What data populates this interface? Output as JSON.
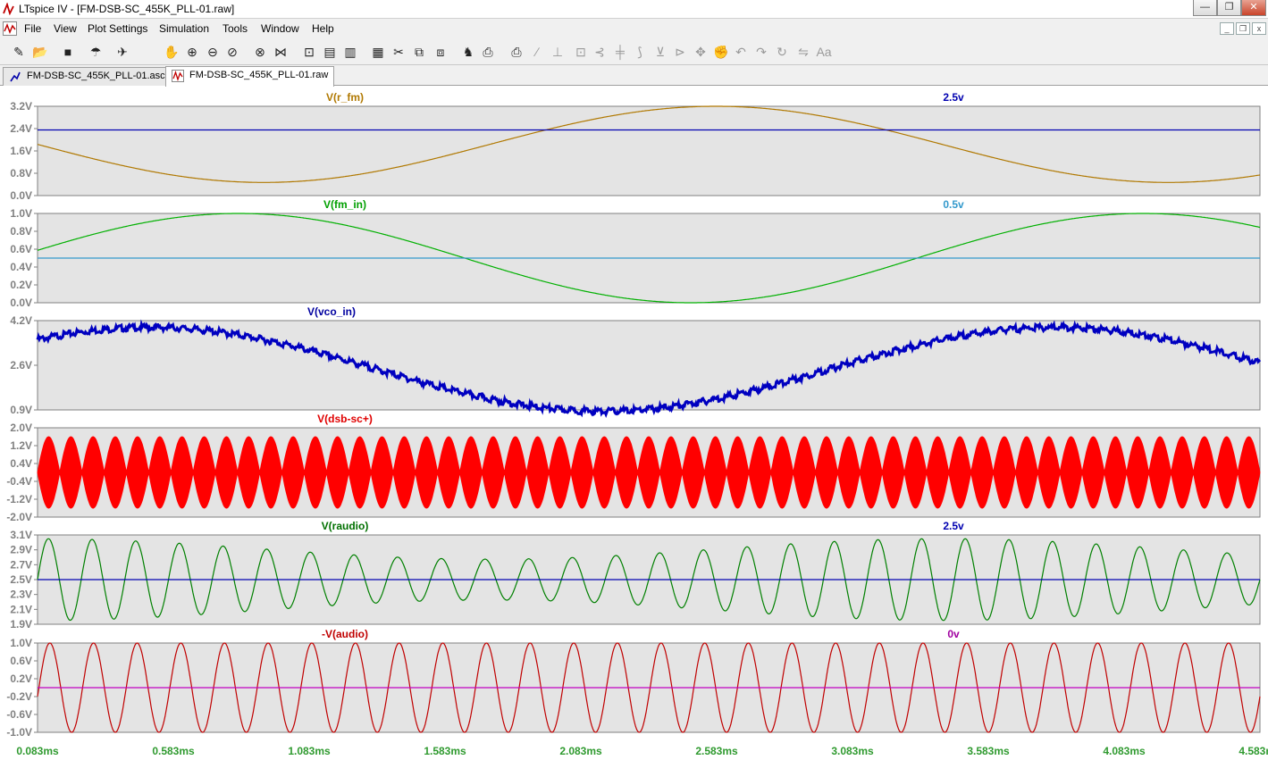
{
  "window": {
    "title": "LTspice IV - [FM-DSB-SC_455K_PLL-01.raw]",
    "controls": [
      "minimize",
      "maximize",
      "close"
    ]
  },
  "menu": {
    "items": [
      "File",
      "View",
      "Plot Settings",
      "Simulation",
      "Tools",
      "Window",
      "Help"
    ]
  },
  "toolbar": {
    "icons": [
      "new-schematic-icon",
      "open-icon",
      "save-icon",
      "control-panel-icon",
      "run-icon",
      "halt-icon",
      "zoom-in-icon",
      "zoom-out-icon",
      "zoom-back-icon",
      "zoom-cancel-icon",
      "autorange-icon",
      "fit-icon",
      "tile-horizontal-icon",
      "cascade-icon",
      "close-window-icon",
      "cut-icon",
      "copy-icon",
      "paste-icon",
      "find-icon",
      "print-setup-icon",
      "print-icon",
      "wire-icon",
      "ground-icon",
      "label-icon",
      "resistor-icon",
      "capacitor-icon",
      "inductor-icon",
      "diode-icon",
      "component-icon",
      "move-icon",
      "drag-icon",
      "undo-icon",
      "redo-icon",
      "rotate-icon",
      "mirror-icon",
      "text-icon",
      "spice-directive-icon"
    ]
  },
  "tabs": [
    {
      "label": "FM-DSB-SC_455K_PLL-01.asc",
      "active": false,
      "icon": "schematic-icon"
    },
    {
      "label": "FM-DSB-SC_455K_PLL-01.raw",
      "active": true,
      "icon": "waveform-icon"
    }
  ],
  "chart_data": [
    {
      "type": "line",
      "title": "V(r_fm)",
      "title_color": "#b07800",
      "ticks": [
        "3.2V",
        "2.4V",
        "1.6V",
        "0.8V",
        "0.0V"
      ],
      "ylim": [
        0.0,
        3.4
      ],
      "series": [
        {
          "name": "V(r_fm)",
          "color": "#b07800",
          "kind": "sine",
          "offset": 1.95,
          "amplitude": 1.45,
          "period_ms": 3.33,
          "phase_deg": 180
        },
        {
          "name": "2.5v",
          "color": "#0000b0",
          "kind": "const",
          "value": 2.5
        }
      ],
      "right_label": "2.5v",
      "right_label_color": "#0000b0"
    },
    {
      "type": "line",
      "title": "V(fm_in)",
      "title_color": "#00a000",
      "ticks": [
        "1.0V",
        "0.8V",
        "0.6V",
        "0.4V",
        "0.2V",
        "0.0V"
      ],
      "ylim": [
        0.0,
        1.0
      ],
      "series": [
        {
          "name": "V(fm_in)",
          "color": "#00b000",
          "kind": "sine",
          "offset": 0.5,
          "amplitude": 0.5,
          "period_ms": 3.33,
          "phase_deg": 10
        },
        {
          "name": "0.5v",
          "color": "#3399cc",
          "kind": "const",
          "value": 0.5
        }
      ],
      "right_label": "0.5v",
      "right_label_color": "#3399cc"
    },
    {
      "type": "line",
      "title": "V(vco_in)",
      "title_color": "#0000a0",
      "ticks": [
        "4.2V",
        "2.6V",
        "0.9V"
      ],
      "ylim": [
        0.9,
        4.2
      ],
      "series": [
        {
          "name": "V(vco_in)",
          "color": "#0000c0",
          "kind": "noisy-sine",
          "offset": 2.4,
          "amplitude": 1.55,
          "period_ms": 3.33,
          "phase_deg": 45
        }
      ]
    },
    {
      "type": "line",
      "title": "V(dsb-sc+)",
      "title_color": "#e00000",
      "ticks": [
        "2.0V",
        "1.2V",
        "0.4V",
        "-0.4V",
        "-1.2V",
        "-2.0V"
      ],
      "ylim": [
        -2.0,
        2.0
      ],
      "series": [
        {
          "name": "V(dsb-sc+)",
          "color": "#ff0000",
          "kind": "envelope",
          "amplitude": 1.6,
          "lobes": 55
        }
      ]
    },
    {
      "type": "line",
      "title": "V(raudio)",
      "title_color": "#007000",
      "ticks": [
        "3.1V",
        "2.9V",
        "2.7V",
        "2.5V",
        "2.3V",
        "2.1V",
        "1.9V"
      ],
      "ylim": [
        1.9,
        3.1
      ],
      "series": [
        {
          "name": "V(raudio)",
          "color": "#008000",
          "kind": "modsine",
          "offset": 2.5,
          "amplitude": 0.55,
          "cycles": 28
        },
        {
          "name": "2.5v",
          "color": "#0000b0",
          "kind": "const",
          "value": 2.5
        }
      ],
      "right_label": "2.5v",
      "right_label_color": "#0000b0"
    },
    {
      "type": "line",
      "title": "-V(audio)",
      "title_color": "#c00000",
      "ticks": [
        "1.0V",
        "0.6V",
        "0.2V",
        "-0.2V",
        "-0.6V",
        "-1.0V"
      ],
      "ylim": [
        -1.0,
        1.0
      ],
      "series": [
        {
          "name": "-V(audio)",
          "color": "#c00000",
          "kind": "sine-cycles",
          "offset": 0.0,
          "amplitude": 1.0,
          "cycles": 28
        },
        {
          "name": "0v",
          "color": "#c000c0",
          "kind": "const",
          "value": 0.0
        }
      ],
      "right_label": "0v",
      "right_label_color": "#a000a0"
    }
  ],
  "x_axis": {
    "ticks": [
      "0.083ms",
      "0.583ms",
      "1.083ms",
      "1.583ms",
      "2.083ms",
      "2.583ms",
      "3.083ms",
      "3.583ms",
      "4.083ms",
      "4.583ms"
    ],
    "xlim": [
      0.083,
      4.583
    ]
  }
}
